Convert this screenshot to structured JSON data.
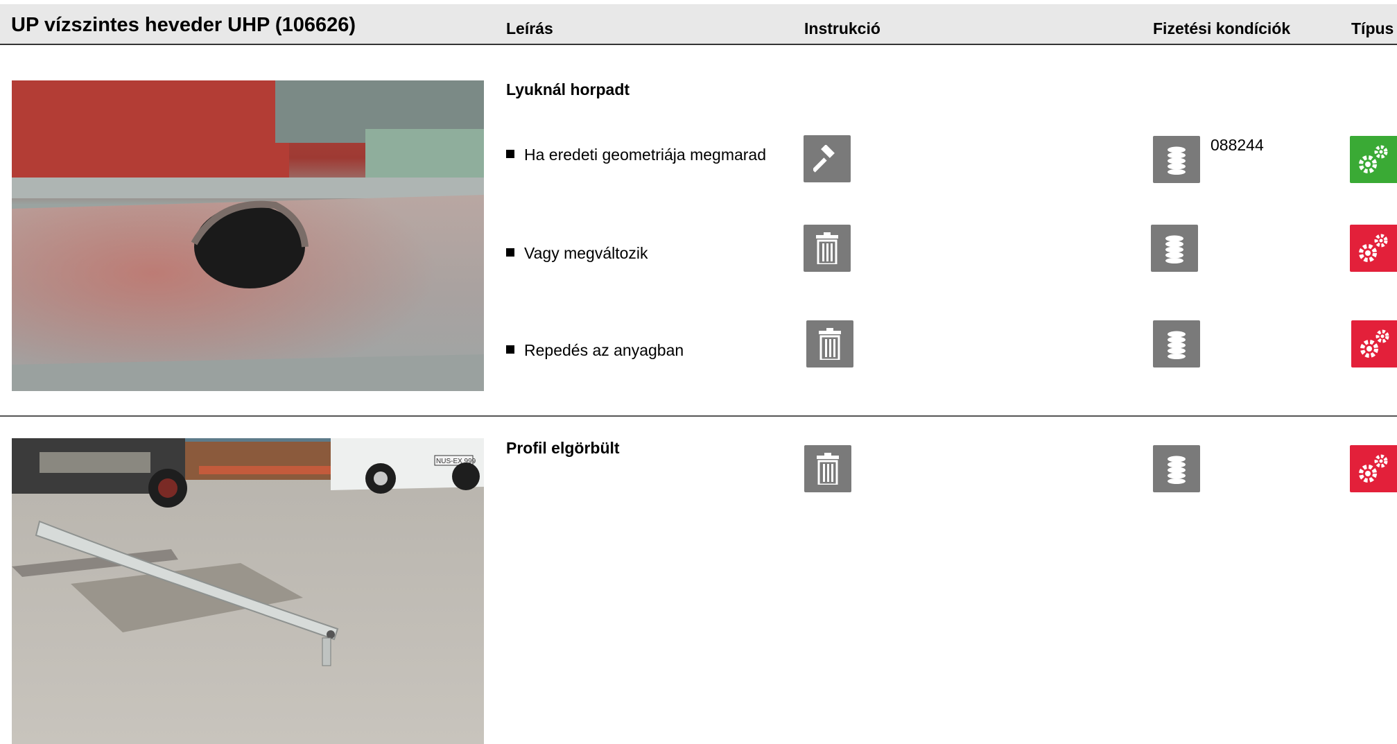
{
  "header": {
    "title": "UP vízszintes heveder UHP (106626)",
    "col_description": "Leírás",
    "col_instruction": "Instrukció",
    "col_payment": "Fizetési kondíciók",
    "col_type": "Típus"
  },
  "colors": {
    "header_bg": "#e8e8e8",
    "icon_bg": "#7a7a7a",
    "type_ok": "#3aaa35",
    "type_bad": "#e3203a"
  },
  "sections": [
    {
      "title": "Lyuknál horpadt",
      "photo_icon": "dented-hole-photo",
      "items": [
        {
          "text": "Ha eredeti geometriája megmarad",
          "instruction_icon": "hammer-icon",
          "payment_icon": "coins-icon",
          "payment_code": "088244",
          "type_icon": "gears-icon",
          "type_color": "green"
        },
        {
          "text": "Vagy megváltozik",
          "instruction_icon": "trash-icon",
          "payment_icon": "coins-icon",
          "payment_code": "",
          "type_icon": "gears-icon",
          "type_color": "red"
        },
        {
          "text": "Repedés az anyagban",
          "instruction_icon": "trash-icon",
          "payment_icon": "coins-icon",
          "payment_code": "",
          "type_icon": "gears-icon",
          "type_color": "red"
        }
      ]
    },
    {
      "title": "Profil elgörbült",
      "photo_icon": "bent-profile-photo",
      "instruction_icon": "trash-icon",
      "payment_icon": "coins-icon",
      "type_icon": "gears-icon",
      "type_color": "red",
      "photo_plate_text": "NUS-EX 999"
    }
  ]
}
